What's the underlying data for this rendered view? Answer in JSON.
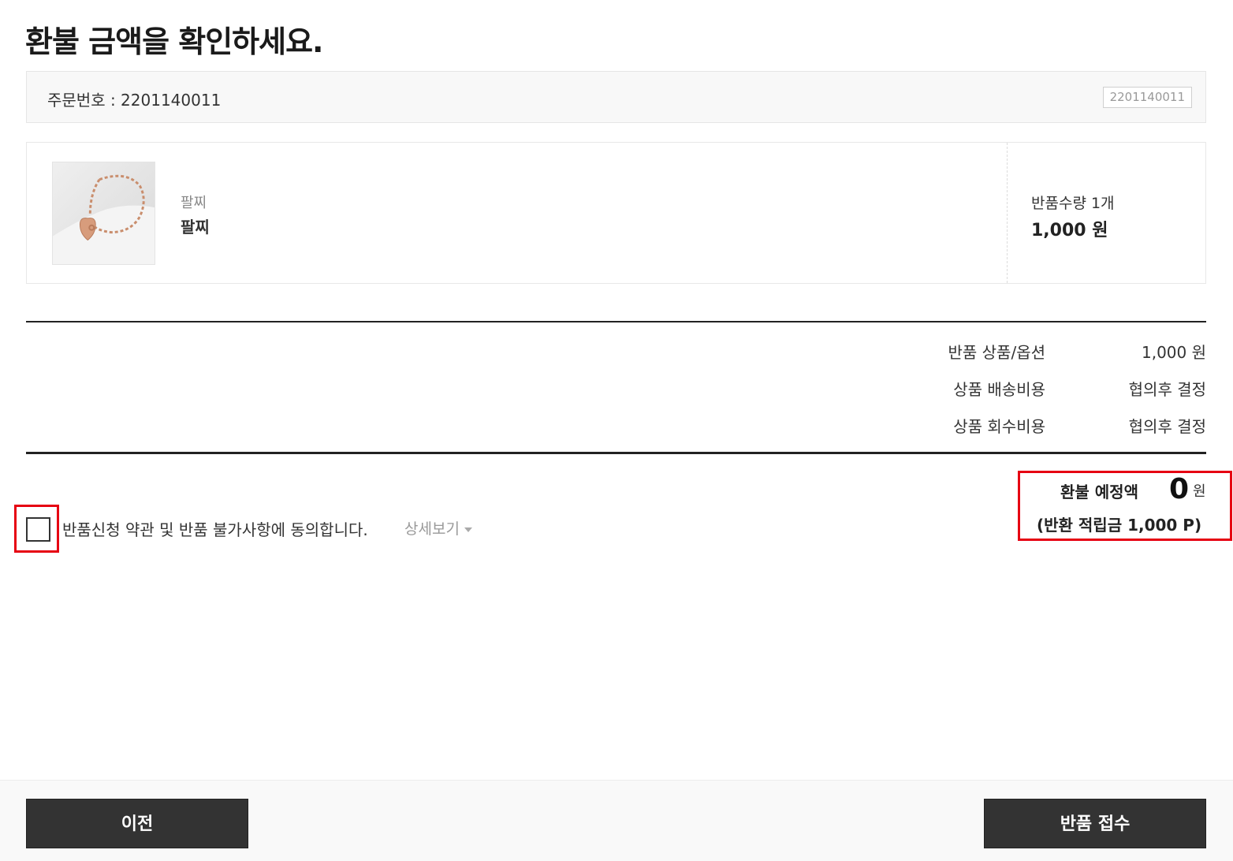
{
  "header": {
    "title": "환불 금액을 확인하세요."
  },
  "order": {
    "label": "주문번호 : 2201140011",
    "chip": "2201140011"
  },
  "product": {
    "image_icon": "bracelet-image",
    "category": "팔찌",
    "name": "팔찌",
    "quantity_label": "반품수량 1개",
    "price": "1,000 원"
  },
  "summary": {
    "rows": [
      {
        "label": "반품 상품/옵션",
        "value": "1,000 원"
      },
      {
        "label": "상품 배송비용",
        "value": "협의후 결정"
      },
      {
        "label": "상품 회수비용",
        "value": "협의후 결정"
      }
    ]
  },
  "refund": {
    "label": "환불 예정액",
    "amount": "0",
    "unit": "원",
    "points": "(반환 적립금  1,000 P)"
  },
  "agreement": {
    "text": "반품신청 약관 및 반품 불가사항에 동의합니다.",
    "detail_link": "상세보기"
  },
  "footer": {
    "prev_label": "이전",
    "submit_label": "반품 접수"
  },
  "colors": {
    "highlight": "#e60012",
    "button_bg": "#333333"
  }
}
